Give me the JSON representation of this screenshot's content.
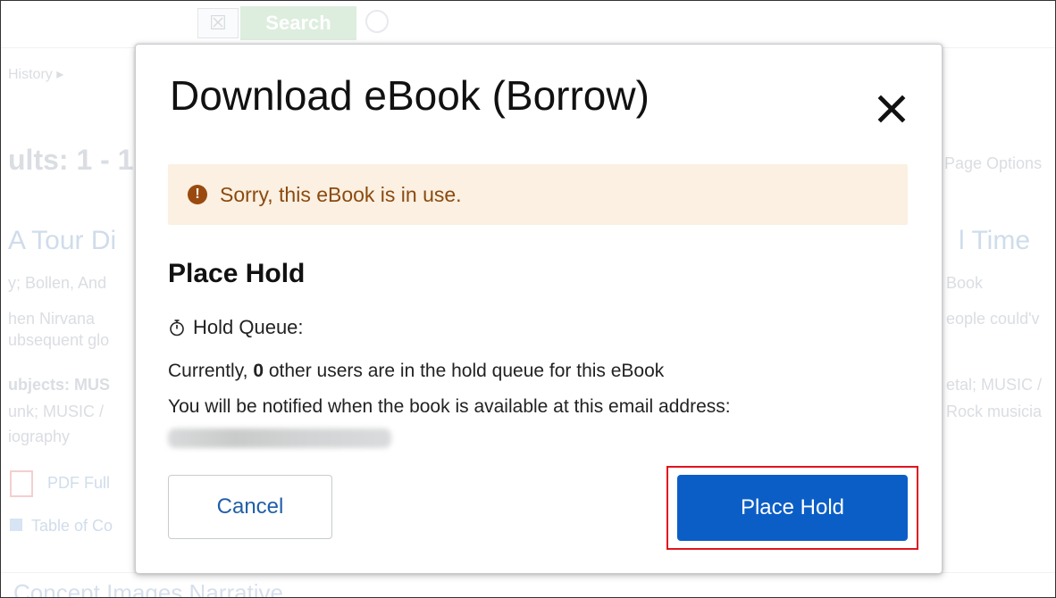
{
  "background": {
    "search_box_glyph": "☒",
    "search_button_label": "Search",
    "history_link": "History ▸",
    "results_heading": "ults: 1 - 1",
    "page_options": "Page Options",
    "result_title_left": "A Tour Di",
    "result_title_right": "l Time",
    "author_left": "y; Bollen, And",
    "author_right": "Book",
    "desc_left_1": "hen Nirvana",
    "desc_left_2": "ubsequent glo",
    "desc_right": "eople could'v",
    "subjects_left_1": "ubjects: MUS",
    "subjects_left_2": "unk; MUSIC /",
    "subjects_left_3": "iography",
    "subjects_right_1": "etal; MUSIC /",
    "subjects_right_2": "Rock musicia",
    "pdf_link": "PDF Full",
    "toc_link": "Table of Co",
    "bottom_text": "Concept  Images  Narrative"
  },
  "modal": {
    "title": "Download eBook (Borrow)",
    "close_glyph": "✕",
    "alert": {
      "icon_glyph": "!",
      "text": "Sorry, this eBook is in use."
    },
    "section_title": "Place Hold",
    "hold_queue_label": "Hold Queue:",
    "queue_prefix": "Currently,",
    "queue_count": "0",
    "queue_suffix": "other users are in the hold queue for this eBook",
    "notify_text": "You will be notified when the book is available at this email address:",
    "cancel_label": "Cancel",
    "place_hold_label": "Place Hold"
  },
  "colors": {
    "primary": "#0b5ec6",
    "alert_bg": "#fbf0e1",
    "alert_text": "#8b4a10",
    "highlight": "#e0141e",
    "link": "#1f5fa8"
  }
}
